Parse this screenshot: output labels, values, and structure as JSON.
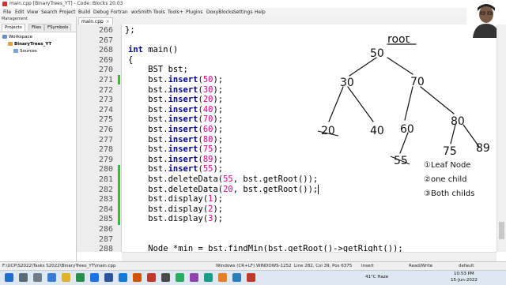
{
  "window": {
    "title": "main.cpp [BinaryTrees_YT] - Code::Blocks 20.03"
  },
  "menu": [
    "File",
    "Edit",
    "View",
    "Search",
    "Project",
    "Build",
    "Debug",
    "Fortran",
    "wxSmith",
    "Tools",
    "Tools+",
    "Plugins",
    "DoxyBlocks",
    "Settings",
    "Help"
  ],
  "sidebar": {
    "label": "Management",
    "tabs": [
      "Projects",
      "Files",
      "FSymbols"
    ],
    "tree": [
      "Workspace",
      "BinaryTrees_YT",
      "Sources"
    ]
  },
  "editor": {
    "tab": "main.cpp",
    "lines": [
      {
        "n": "266",
        "text": "};"
      },
      {
        "n": "267",
        "text": ""
      },
      {
        "n": "268",
        "text": "int main()"
      },
      {
        "n": "269",
        "text": "{"
      },
      {
        "n": "270",
        "text": "    BST bst;"
      },
      {
        "n": "271",
        "text": "    bst.insert(50);"
      },
      {
        "n": "272",
        "text": "    bst.insert(30);"
      },
      {
        "n": "273",
        "text": "    bst.insert(20);"
      },
      {
        "n": "274",
        "text": "    bst.insert(40);"
      },
      {
        "n": "275",
        "text": "    bst.insert(70);"
      },
      {
        "n": "276",
        "text": "    bst.insert(60);"
      },
      {
        "n": "277",
        "text": "    bst.insert(80);"
      },
      {
        "n": "278",
        "text": "    bst.insert(75);"
      },
      {
        "n": "279",
        "text": "    bst.insert(89);"
      },
      {
        "n": "280",
        "text": "    bst.insert(55);"
      },
      {
        "n": "281",
        "text": "    bst.deleteData(55, bst.getRoot());"
      },
      {
        "n": "282",
        "text": "    bst.deleteData(20, bst.getRoot());"
      },
      {
        "n": "283",
        "text": "    bst.display(1);"
      },
      {
        "n": "284",
        "text": "    bst.display(2);"
      },
      {
        "n": "285",
        "text": "    bst.display(3);"
      },
      {
        "n": "286",
        "text": ""
      },
      {
        "n": "287",
        "text": ""
      },
      {
        "n": "288",
        "text": "    Node *min = bst.findMin(bst.getRoot()->getRight());"
      }
    ]
  },
  "annotation": {
    "root_label": "root",
    "nodes": [
      "50",
      "30",
      "70",
      "20",
      "40",
      "60",
      "80",
      "55",
      "75",
      "89"
    ],
    "cases": [
      "①Leaf Node",
      "②one child",
      "③Both childs"
    ]
  },
  "status": {
    "path": "F:\\UCP\\S2022\\Tasks S2022\\BinaryTrees_YT\\main.cpp",
    "eol": "Windows (CR+LF)",
    "encoding": "WINDOWS-1252",
    "position": "Line 282, Col 39, Pos 6375",
    "mode": "Insert",
    "access": "Read/Write",
    "misc": "default"
  },
  "taskbar": {
    "weather": "41°C  Haze",
    "time": "10:53 PM",
    "date": "15-Jun-2022"
  },
  "colors": {
    "keyword": "#00008b",
    "number": "#e0008a",
    "change_marker": "#2fbf3a",
    "ink": "#111111"
  }
}
